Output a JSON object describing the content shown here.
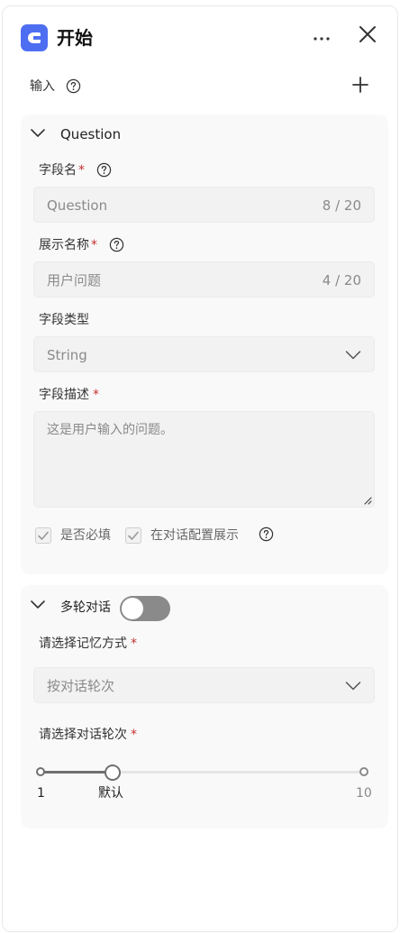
{
  "header": {
    "title": "开始"
  },
  "inputs": {
    "label": "输入"
  },
  "question": {
    "section_title": "Question",
    "field_name": {
      "label": "字段名",
      "required_mark": "*",
      "value": "Question",
      "count": "8 / 20"
    },
    "display_name": {
      "label": "展示名称",
      "required_mark": "*",
      "value": "用户问题",
      "count": "4 / 20"
    },
    "field_type": {
      "label": "字段类型",
      "value": "String"
    },
    "field_desc": {
      "label": "字段描述",
      "required_mark": "*",
      "value": "这是用户输入的问题。"
    },
    "required_check": {
      "label": "是否必填",
      "checked": true
    },
    "show_in_dialog_check": {
      "label": "在对话配置展示",
      "checked": true
    }
  },
  "multi_turn": {
    "section_title": "多轮对话",
    "enabled": false,
    "memory_mode": {
      "label": "请选择记忆方式",
      "required_mark": "*",
      "value": "按对话轮次"
    },
    "turns": {
      "label": "请选择对话轮次",
      "required_mark": "*",
      "min_label": "1",
      "default_label": "默认",
      "max_label": "10",
      "min": 1,
      "max": 10,
      "value": 3
    }
  },
  "colors": {
    "accent": "#4e6ef2",
    "required": "#c5322f",
    "toggle_off": "#8a8a8a"
  }
}
